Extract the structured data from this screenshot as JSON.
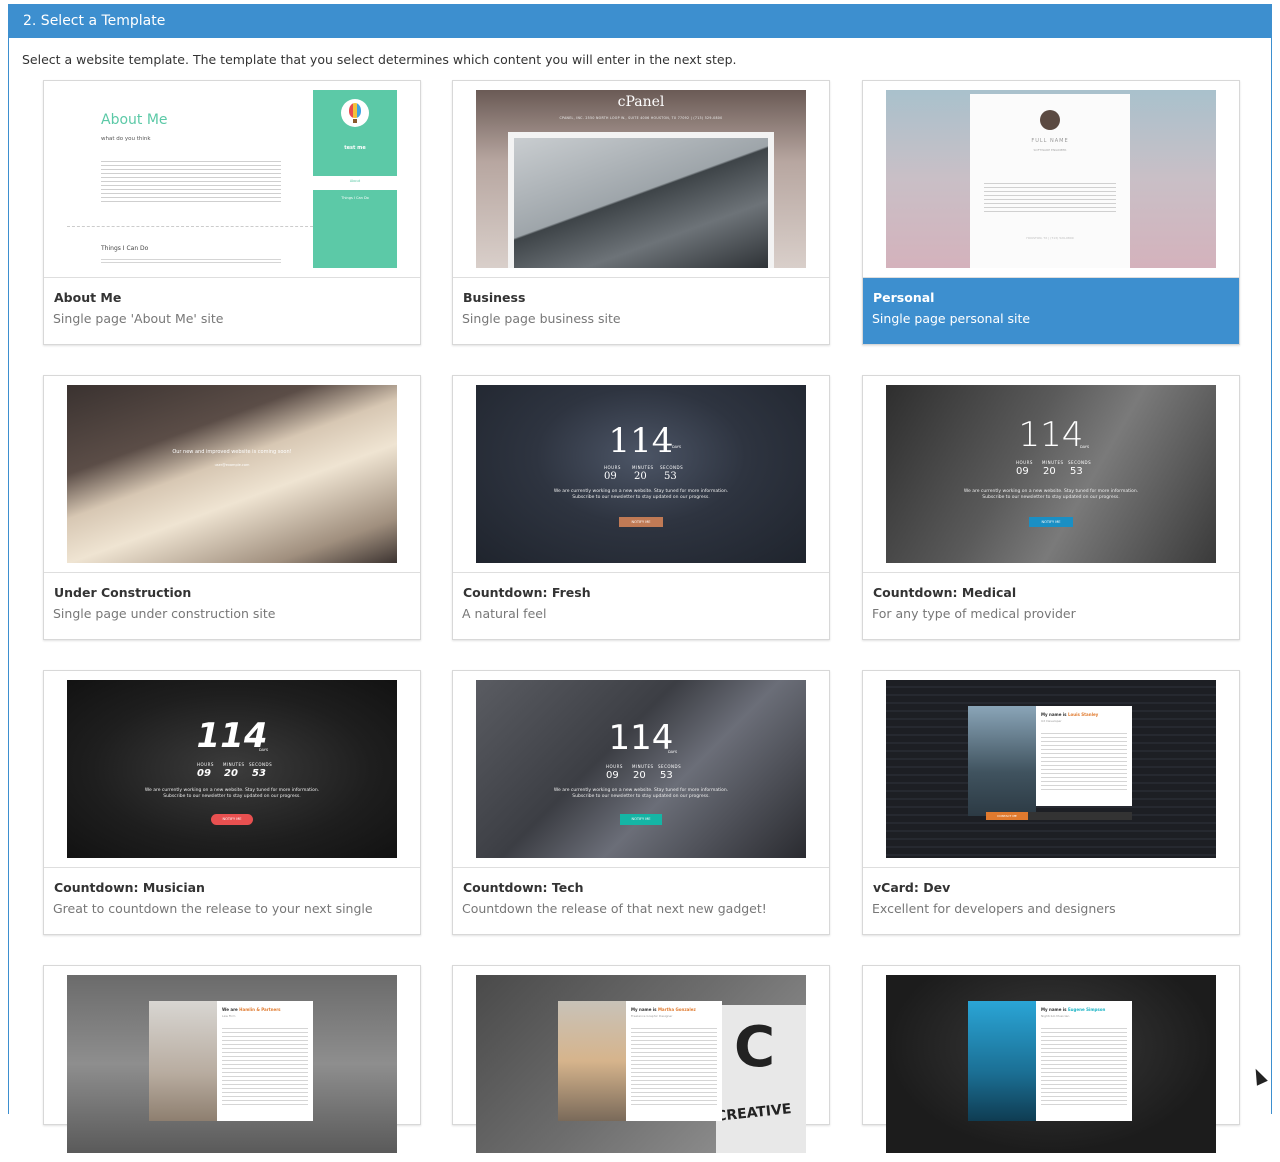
{
  "panel": {
    "title": "2. Select a Template"
  },
  "intro": "Select a website template. The template that you select determines which content you will enter in the next step.",
  "templates": [
    {
      "title": "About Me",
      "desc": "Single page 'About Me' site",
      "selected": false,
      "thumb": {
        "heading": "About Me",
        "sub": "what do you think",
        "side_name": "test me",
        "side_link": "About",
        "side_box": "Things I Can Do",
        "section": "Things I Can Do"
      }
    },
    {
      "title": "Business",
      "desc": "Single page business site",
      "selected": false,
      "thumb": {
        "brand": "cPanel",
        "address": "CPANEL, INC. 2550 NORTH LOOP W., SUITE 4006 HOUSTON, TX 77092 | (713) 529-0800"
      }
    },
    {
      "title": "Personal",
      "desc": "Single page personal site",
      "selected": true,
      "thumb": {
        "name": "FULL NAME",
        "subtitle": "SOFTWARE ENGINEER",
        "location": "HOUSTON, TX | (713) 529-0800"
      }
    },
    {
      "title": "Under Construction",
      "desc": "Single page under construction site",
      "selected": false,
      "thumb": {
        "line": "Our new and improved website is coming soon!",
        "email": "user@example.com"
      }
    },
    {
      "title": "Countdown: Fresh",
      "desc": "A natural feel",
      "selected": false,
      "thumb": {
        "days": "114",
        "days_label": "DAYS",
        "hours": "09",
        "minutes": "20",
        "seconds": "53",
        "cta": "NOTIFY ME"
      }
    },
    {
      "title": "Countdown: Medical",
      "desc": "For any type of medical provider",
      "selected": false,
      "thumb": {
        "days": "114",
        "days_label": "DAYS",
        "hours": "09",
        "minutes": "20",
        "seconds": "53",
        "cta": "NOTIFY ME"
      }
    },
    {
      "title": "Countdown: Musician",
      "desc": "Great to countdown the release to your next single",
      "selected": false,
      "thumb": {
        "days": "114",
        "days_label": "DAYS",
        "hours": "09",
        "minutes": "20",
        "seconds": "53",
        "cta": "NOTIFY ME"
      }
    },
    {
      "title": "Countdown: Tech",
      "desc": "Countdown the release of that next new gadget!",
      "selected": false,
      "thumb": {
        "days": "114",
        "days_label": "DAYS",
        "hours": "09",
        "minutes": "20",
        "seconds": "53",
        "cta": "NOTIFY ME"
      }
    },
    {
      "title": "vCard: Dev",
      "desc": "Excellent for developers and designers",
      "selected": false,
      "thumb": {
        "greeting": "My name is ",
        "name": "Louis Stanley",
        "role": "UX Developer",
        "cta": "CONTACT ME"
      }
    },
    {
      "title": "",
      "desc": "",
      "selected": false,
      "thumb": {
        "greeting": "We are ",
        "name": "Hamlin & Partners",
        "role": "Law Firm"
      }
    },
    {
      "title": "",
      "desc": "",
      "selected": false,
      "thumb": {
        "greeting": "My name is ",
        "name": "Martha Gonzalez",
        "role": "Freelance Graphic Designer",
        "bg_word": "CREATIVE"
      }
    },
    {
      "title": "",
      "desc": "",
      "selected": false,
      "thumb": {
        "greeting": "My name is ",
        "name": "Eugene Simpson",
        "role": "Nightclub Musician"
      }
    }
  ],
  "countdown_labels": {
    "hours": "HOURS",
    "minutes": "MINUTES",
    "seconds": "SECONDS"
  },
  "countdown_message": "We are currently working on a new website. Stay tuned for more information. Subscribe to our newsletter to stay updated on our progress.",
  "colors": {
    "accent": "#3d8fcf",
    "about_green": "#5cc9a7",
    "fresh_btn": "#c07a55",
    "medical_btn": "#1a8fc4",
    "musician_btn": "#e85050",
    "tech_btn": "#15b5a5",
    "dev_orange": "#e07a2e",
    "law_orange": "#e07a2e",
    "music_teal": "#1ab3c4"
  },
  "icons": {
    "balloon": "balloon-icon",
    "avatar": "avatar-icon",
    "cursor": "mouse-cursor-icon"
  }
}
